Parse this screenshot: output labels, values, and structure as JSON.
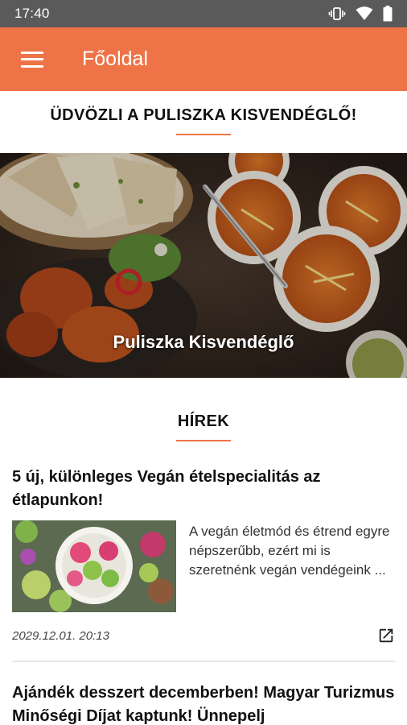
{
  "status": {
    "time": "17:40"
  },
  "appbar": {
    "title": "Főoldal"
  },
  "welcome": {
    "heading": "ÜDVÖZLI A PULISZKA KISVENDÉGLŐ!"
  },
  "hero": {
    "caption": "Puliszka Kisvendéglő"
  },
  "news": {
    "heading": "HÍREK",
    "articles": [
      {
        "title": "5 új, különleges Vegán ételspecialitás az étlapunkon!",
        "excerpt": "A vegán életmód és étrend egyre népszerűbb, ezért mi is szeretnénk vegán vendégeink ...",
        "date": "2029.12.01. 20:13"
      },
      {
        "title": "Ajándék desszert decemberben! Magyar Turizmus Minőségi Díjat kaptunk! Ünnepelj"
      }
    ]
  },
  "colors": {
    "accent": "#ee7347",
    "statusbar": "#5a5a5a"
  },
  "icons": [
    "menu-icon",
    "vibrate-icon",
    "wifi-icon",
    "battery-icon",
    "open-in-new-icon"
  ]
}
